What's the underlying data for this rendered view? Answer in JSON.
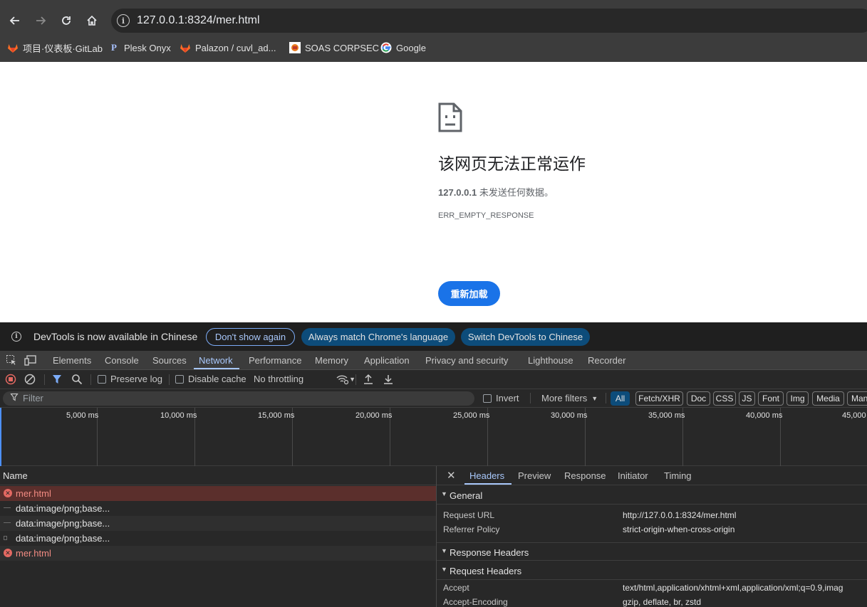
{
  "browser": {
    "url": "127.0.0.1:8324/mer.html",
    "bookmarks": [
      {
        "label": "项目·仪表板·GitLab",
        "icon": "gitlab-icon"
      },
      {
        "label": "Plesk Onyx",
        "icon": "plesk-icon"
      },
      {
        "label": "Palazon / cuvl_ad...",
        "icon": "gitlab-icon"
      },
      {
        "label": "SOAS CORPSEC",
        "icon": "soas-icon"
      },
      {
        "label": "Google",
        "icon": "google-icon"
      }
    ]
  },
  "error_page": {
    "title": "该网页无法正常运作",
    "host": "127.0.0.1",
    "desc_suffix": " 未发送任何数据。",
    "code": "ERR_EMPTY_RESPONSE",
    "reload_label": "重新加载"
  },
  "devtools": {
    "infobar": {
      "message": "DevTools is now available in Chinese",
      "dont_show": "Don't show again",
      "always_match": "Always match Chrome's language",
      "switch": "Switch DevTools to Chinese"
    },
    "tabs": [
      "Elements",
      "Console",
      "Sources",
      "Network",
      "Performance",
      "Memory",
      "Application",
      "Privacy and security",
      "Lighthouse",
      "Recorder"
    ],
    "active_tab": "Network",
    "toolbar": {
      "preserve_log": "Preserve log",
      "disable_cache": "Disable cache",
      "throttling": "No throttling"
    },
    "filter": {
      "placeholder": "Filter",
      "invert": "Invert",
      "more_filters": "More filters",
      "types": [
        "All",
        "Fetch/XHR",
        "Doc",
        "CSS",
        "JS",
        "Font",
        "Img",
        "Media",
        "Man"
      ],
      "selected_type": "All"
    },
    "timeline_ticks": [
      "5,000 ms",
      "10,000 ms",
      "15,000 ms",
      "20,000 ms",
      "25,000 ms",
      "30,000 ms",
      "35,000 ms",
      "40,000 ms",
      "45,000"
    ],
    "requests": {
      "header": "Name",
      "rows": [
        {
          "name": "mer.html",
          "status": "error",
          "selected": true
        },
        {
          "name": "data:image/png;base...",
          "status": "ok",
          "selected": false
        },
        {
          "name": "data:image/png;base...",
          "status": "ok",
          "selected": false
        },
        {
          "name": "data:image/png;base...",
          "status": "ok",
          "selected": false
        },
        {
          "name": "mer.html",
          "status": "error",
          "selected": false
        }
      ]
    },
    "details": {
      "tabs": [
        "Headers",
        "Preview",
        "Response",
        "Initiator",
        "Timing"
      ],
      "active_tab": "Headers",
      "general_title": "General",
      "general": [
        {
          "key": "Request URL",
          "value": "http://127.0.0.1:8324/mer.html"
        },
        {
          "key": "Referrer Policy",
          "value": "strict-origin-when-cross-origin"
        }
      ],
      "response_headers_title": "Response Headers",
      "request_headers_title": "Request Headers",
      "request_headers": [
        {
          "key": "Accept",
          "value": "text/html,application/xhtml+xml,application/xml;q=0.9,imag"
        },
        {
          "key": "Accept-Encoding",
          "value": "gzip, deflate, br, zstd"
        }
      ]
    }
  }
}
